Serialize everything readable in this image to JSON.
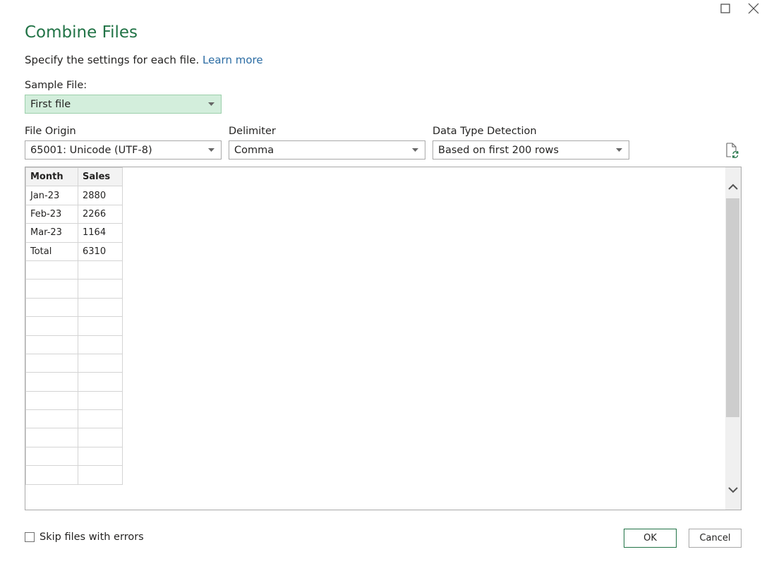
{
  "window": {
    "maximize_icon": "maximize-icon",
    "close_icon": "close-icon"
  },
  "dialog": {
    "title": "Combine Files",
    "subtitle": "Specify the settings for each file.",
    "learn_more": "Learn more"
  },
  "sample_file": {
    "label": "Sample File:",
    "value": "First file"
  },
  "file_origin": {
    "label": "File Origin",
    "value": "65001: Unicode (UTF-8)"
  },
  "delimiter": {
    "label": "Delimiter",
    "value": "Comma"
  },
  "data_type_detection": {
    "label": "Data Type Detection",
    "value": "Based on first 200 rows"
  },
  "refresh_icon": "refresh-file-icon",
  "preview": {
    "columns": [
      "Month",
      "Sales"
    ],
    "rows": [
      [
        "Jan-23",
        "2880"
      ],
      [
        "Feb-23",
        "2266"
      ],
      [
        "Mar-23",
        "1164"
      ],
      [
        "Total",
        "6310"
      ]
    ]
  },
  "skip_errors": {
    "label": "Skip files with errors",
    "checked": false
  },
  "buttons": {
    "ok": "OK",
    "cancel": "Cancel"
  },
  "colors": {
    "accent": "#217346",
    "link": "#2b6ca3",
    "sample_file_bg": "#d3eedc"
  }
}
